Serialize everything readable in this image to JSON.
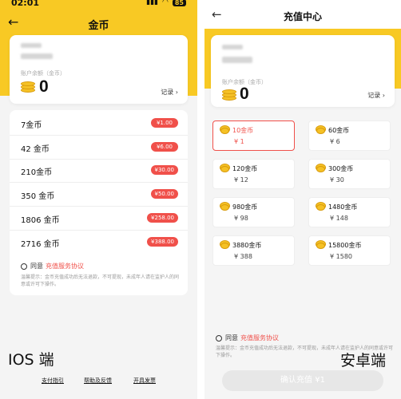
{
  "ios": {
    "status_time": "02:01",
    "battery": "85",
    "title": "金币",
    "balance_label": "账户余额（金币）",
    "balance": "0",
    "record_label": "记录",
    "packages": [
      {
        "coins": "7金币",
        "price": "¥1.00"
      },
      {
        "coins": "42 金币",
        "price": "¥6.00"
      },
      {
        "coins": "210金币",
        "price": "¥30.00"
      },
      {
        "coins": "350 金币",
        "price": "¥50.00"
      },
      {
        "coins": "1806 金币",
        "price": "¥258.00"
      },
      {
        "coins": "2716 金币",
        "price": "¥388.00"
      }
    ],
    "agree_label": "同意",
    "agreement_link": "充值服务协议",
    "tip": "温馨提示：金币充值成功后无法退款，不可提现，未成年人请在监护人的同意或许可下操作。",
    "platform_label": "IOS 端",
    "footer_links": [
      "支付指引",
      "帮助及反馈",
      "开具发票"
    ]
  },
  "android": {
    "title": "充值中心",
    "balance_label": "账户余额（金币）",
    "balance": "0",
    "record_label": "记录",
    "packages": [
      {
        "coins": "10金币",
        "price": "¥ 1",
        "selected": true
      },
      {
        "coins": "60金币",
        "price": "¥ 6",
        "selected": false
      },
      {
        "coins": "120金币",
        "price": "¥ 12",
        "selected": false
      },
      {
        "coins": "300金币",
        "price": "¥ 30",
        "selected": false
      },
      {
        "coins": "980金币",
        "price": "¥ 98",
        "selected": false
      },
      {
        "coins": "1480金币",
        "price": "¥ 148",
        "selected": false
      },
      {
        "coins": "3880金币",
        "price": "¥ 388",
        "selected": false
      },
      {
        "coins": "15800金币",
        "price": "¥ 1580",
        "selected": false
      }
    ],
    "agree_label": "同意",
    "agreement_link": "充值服务协议",
    "tip": "温馨提示：金币充值成功后无法退款，不可提现，未成年人请在监护人的同意或许可下操作。",
    "platform_label": "安卓端",
    "confirm_button": "确认充值 ¥1"
  },
  "colors": {
    "brand_yellow": "#f8c924",
    "accent_red": "#f0504a",
    "coin_gold": "#f5c125"
  }
}
